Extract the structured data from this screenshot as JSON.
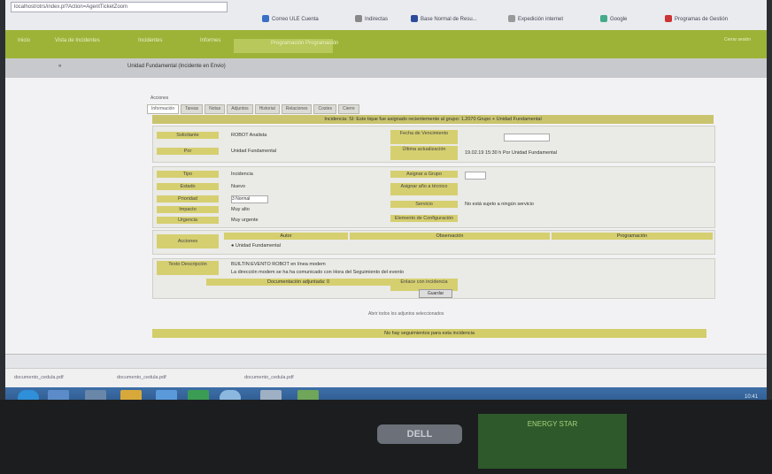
{
  "browser": {
    "url": "localhost/otrs/index.pl?Action=AgentTicketZoom",
    "bookmarks": [
      "Correo ULE Cuenta",
      "Indirectas",
      "Base Normal de Resu...",
      "Expedición internet",
      "Google",
      "Programas de Gestión"
    ]
  },
  "appbar": {
    "nav": [
      "Inicio",
      "Vista de Incidentes",
      "Incidentes",
      "Informes",
      "Programación Programación"
    ],
    "right": "Cerrar sesión"
  },
  "breadcrumb": {
    "back": "«",
    "title": "Unidad Fundamental (Incidente en Envio)"
  },
  "tabs": [
    "Información",
    "Tareas",
    "Notas",
    "Adjuntos",
    "Historial",
    "Relaciones",
    "Costes",
    "Cierre"
  ],
  "toolbar_label": "Acciones",
  "header_band": "Incidencia: SI: Este tique fue asignado recientemente al grupo: 1.2070 Grupo + Unidad Fundamental",
  "details": {
    "solicitante_label": "Solicitante",
    "solicitante_value": "ROBOT Analista",
    "por_label": "Por",
    "por_value": "Unidad Fundamental",
    "fecha_label": "Fecha de Vencimiento",
    "fecha_value": "",
    "ultima_label": "Última actualización",
    "ultima_value": "19.02.19 15:30 h Por Unidad Fundamental"
  },
  "classification": {
    "tipo_label": "Tipo",
    "tipo_value": "Incidencia",
    "estado_label": "Estado",
    "estado_value": "Nuevo",
    "prioridad_label": "Prioridad",
    "prioridad_value": "3 Normal",
    "impacto_label": "Impacto",
    "impacto_value": "Muy alto",
    "urgencia_label": "Urgencia",
    "urgencia_value": "Muy urgente",
    "grupo_label": "Asignar a Grupo",
    "grupo_value": "",
    "asignado_label": "Asignar año a técnico",
    "servicio_label": "Servicio",
    "servicio_value": "No está sujeto a ningún servicio",
    "elemento_label": "Elemento de Configuración"
  },
  "actions": {
    "section_label": "Acciones",
    "col_autor": "Autor",
    "col_obs": "Observación",
    "col_prog": "Programación",
    "row_author": "Unidad Fundamental"
  },
  "description": {
    "label": "Texto Descripción",
    "line1": "BUILTIN:EVENTO ROBOT en línea modem",
    "line2": "La dirección modem se ha ha comunicado con Hora del Seguimiento del evento"
  },
  "bottom": {
    "doc_label": "Documentación adjuntada: 0",
    "enlace_label": "Enlace con incidencia",
    "submit": "Guardar",
    "note": "Abrir todos los adjuntos seleccionados",
    "footer": "No hay seguimientos para esta incidencia"
  },
  "downloads": [
    "documento_cedula.pdf",
    "documento_cedula.pdf",
    "documento_cedula.pdf"
  ],
  "tray": "10:41",
  "bezel": {
    "brand": "DELL",
    "sticker": "ENERGY STAR"
  }
}
